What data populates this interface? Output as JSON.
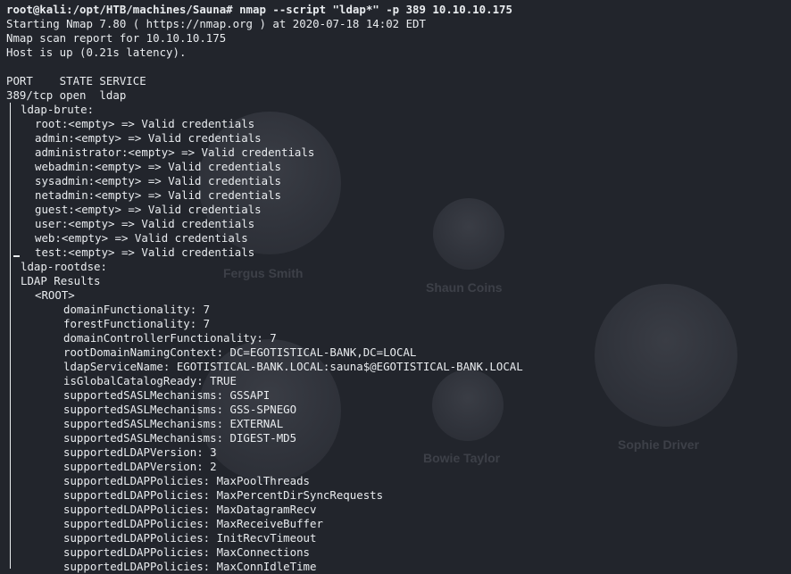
{
  "background": {
    "people": [
      {
        "name": "Fergus Smith"
      },
      {
        "name": "Shaun Coins"
      },
      {
        "name": "Sophie Driver"
      },
      {
        "name": "Bowie Taylor"
      }
    ]
  },
  "terminal": {
    "command_line": "root@kali:/opt/HTB/machines/Sauna# nmap --script \"ldap*\" -p 389 10.10.10.175",
    "start": "Starting Nmap 7.80 ( https://nmap.org ) at 2020-07-18 14:02 EDT",
    "report": "Nmap scan report for 10.10.10.175",
    "host_up": "Host is up (0.21s latency).",
    "port_header": "PORT    STATE SERVICE",
    "port_row": "389/tcp open  ldap",
    "ldap_brute_title": "ldap-brute:",
    "brute_results": [
      "root:<empty> => Valid credentials",
      "admin:<empty> => Valid credentials",
      "administrator:<empty> => Valid credentials",
      "webadmin:<empty> => Valid credentials",
      "sysadmin:<empty> => Valid credentials",
      "netadmin:<empty> => Valid credentials",
      "guest:<empty> => Valid credentials",
      "user:<empty> => Valid credentials",
      "web:<empty> => Valid credentials",
      "test:<empty> => Valid credentials"
    ],
    "rootdse_title": "ldap-rootdse:",
    "ldap_results": "LDAP Results",
    "root_tag": "<ROOT>",
    "rootdse_entries": [
      "domainFunctionality: 7",
      "forestFunctionality: 7",
      "domainControllerFunctionality: 7",
      "rootDomainNamingContext: DC=EGOTISTICAL-BANK,DC=LOCAL",
      "ldapServiceName: EGOTISTICAL-BANK.LOCAL:sauna$@EGOTISTICAL-BANK.LOCAL",
      "isGlobalCatalogReady: TRUE",
      "supportedSASLMechanisms: GSSAPI",
      "supportedSASLMechanisms: GSS-SPNEGO",
      "supportedSASLMechanisms: EXTERNAL",
      "supportedSASLMechanisms: DIGEST-MD5",
      "supportedLDAPVersion: 3",
      "supportedLDAPVersion: 2",
      "supportedLDAPPolicies: MaxPoolThreads",
      "supportedLDAPPolicies: MaxPercentDirSyncRequests",
      "supportedLDAPPolicies: MaxDatagramRecv",
      "supportedLDAPPolicies: MaxReceiveBuffer",
      "supportedLDAPPolicies: InitRecvTimeout",
      "supportedLDAPPolicies: MaxConnections",
      "supportedLDAPPolicies: MaxConnIdleTime"
    ]
  },
  "colors": {
    "background": "#22252c",
    "text": "#e9ecef",
    "faded_name": "#3d4048"
  }
}
